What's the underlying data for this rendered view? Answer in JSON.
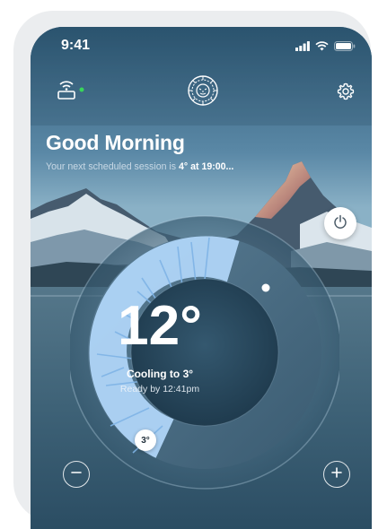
{
  "status_bar": {
    "time": "9:41",
    "icons": [
      "cellular-signal-icon",
      "wifi-icon",
      "battery-icon"
    ]
  },
  "header": {
    "left_icon": "router-wifi-icon",
    "connection_status_color": "#38d65a",
    "logo": "lion-emblem-logo",
    "right_icon": "gear-icon"
  },
  "greeting": {
    "title": "Good Morning",
    "subtitle_prefix": "Your next scheduled session is ",
    "subtitle_highlight": "4° at 19:00..."
  },
  "thermostat": {
    "current_temp": "12°",
    "status": "Cooling to 3°",
    "ready_text": "Ready by 12:41pm",
    "target_badge": "3°",
    "mode": "cooling",
    "accent_color": "#a9cff4"
  },
  "controls": {
    "power_icon": "power-icon",
    "decrease_icon": "minus-circle-icon",
    "increase_icon": "plus-circle-icon"
  }
}
